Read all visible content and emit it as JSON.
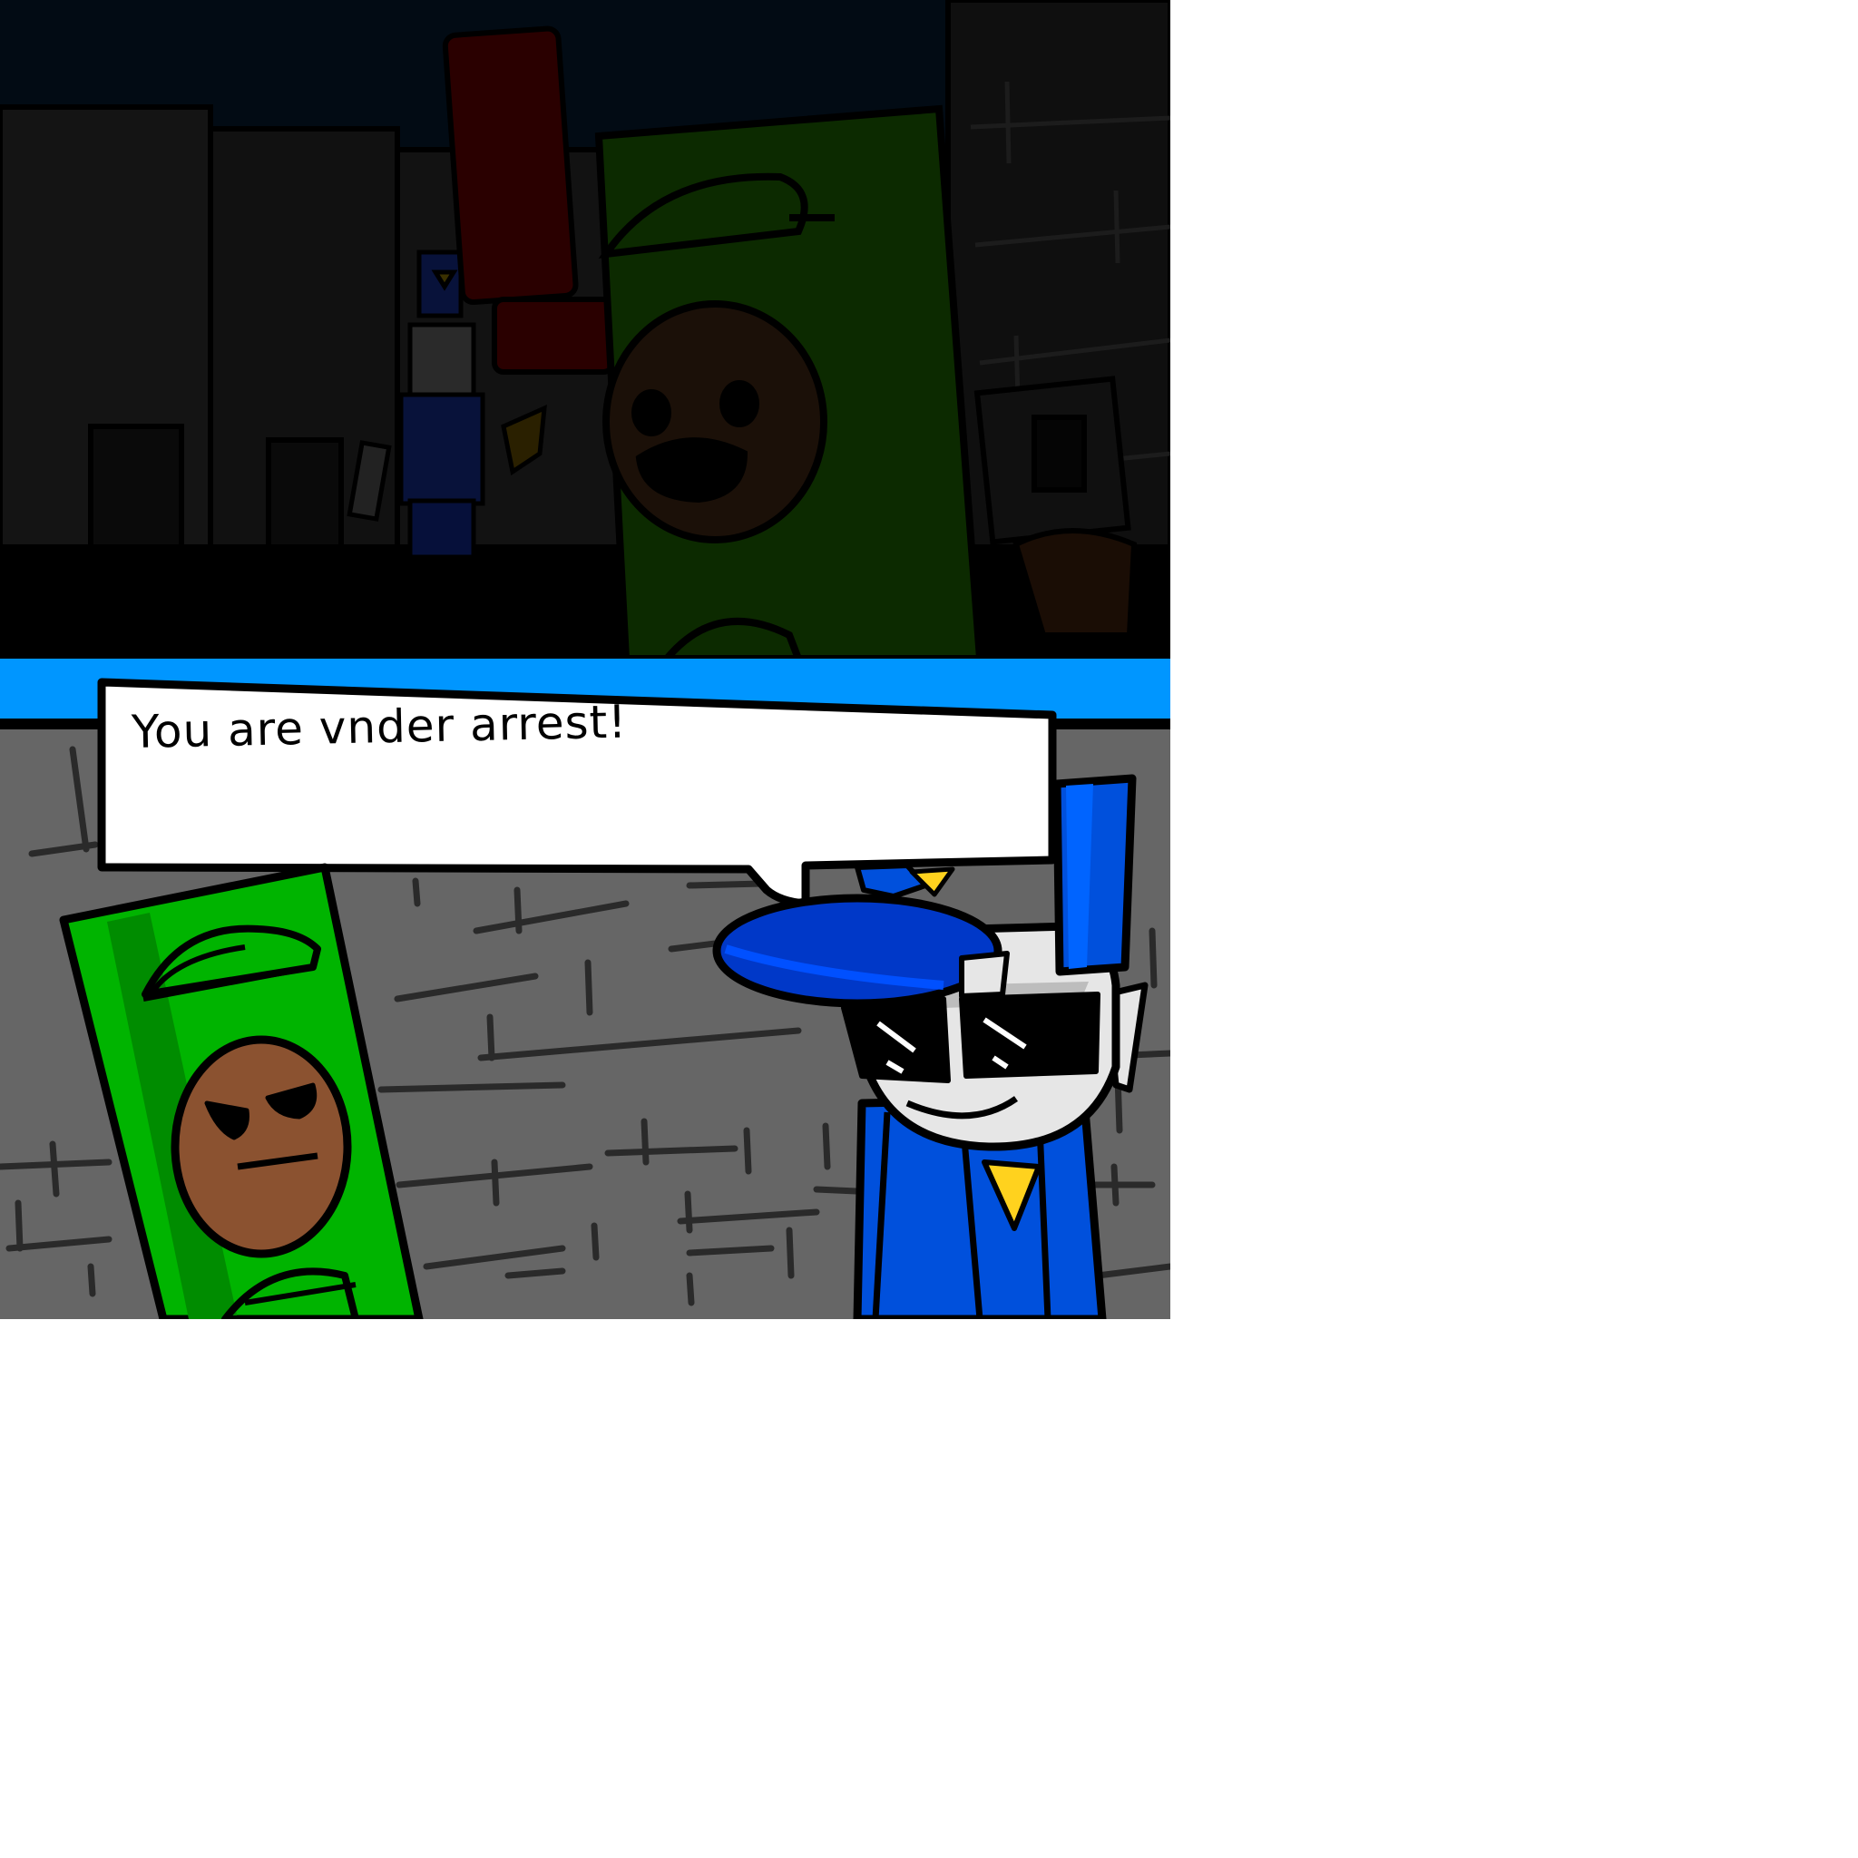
{
  "speech_bubble": {
    "text": "You are vnder arrest!"
  },
  "colors": {
    "night_sky": "#020b14",
    "night_building": "#141414",
    "ground_dark": "#000000",
    "divider_blue": "#0096ff",
    "wall_gray": "#666666",
    "brick_line": "#2a2a2a",
    "green_body": "#00b400",
    "green_dark": "#008c00",
    "face_brown": "#8b5230",
    "police_blue": "#0050dc",
    "police_blue_light": "#0064ff",
    "badge_yellow": "#ffd21e",
    "skin_light": "#e6e6e6"
  },
  "characters": [
    {
      "name": "green-character",
      "expression": "annoyed"
    },
    {
      "name": "police-officer",
      "expression": "smug"
    }
  ]
}
